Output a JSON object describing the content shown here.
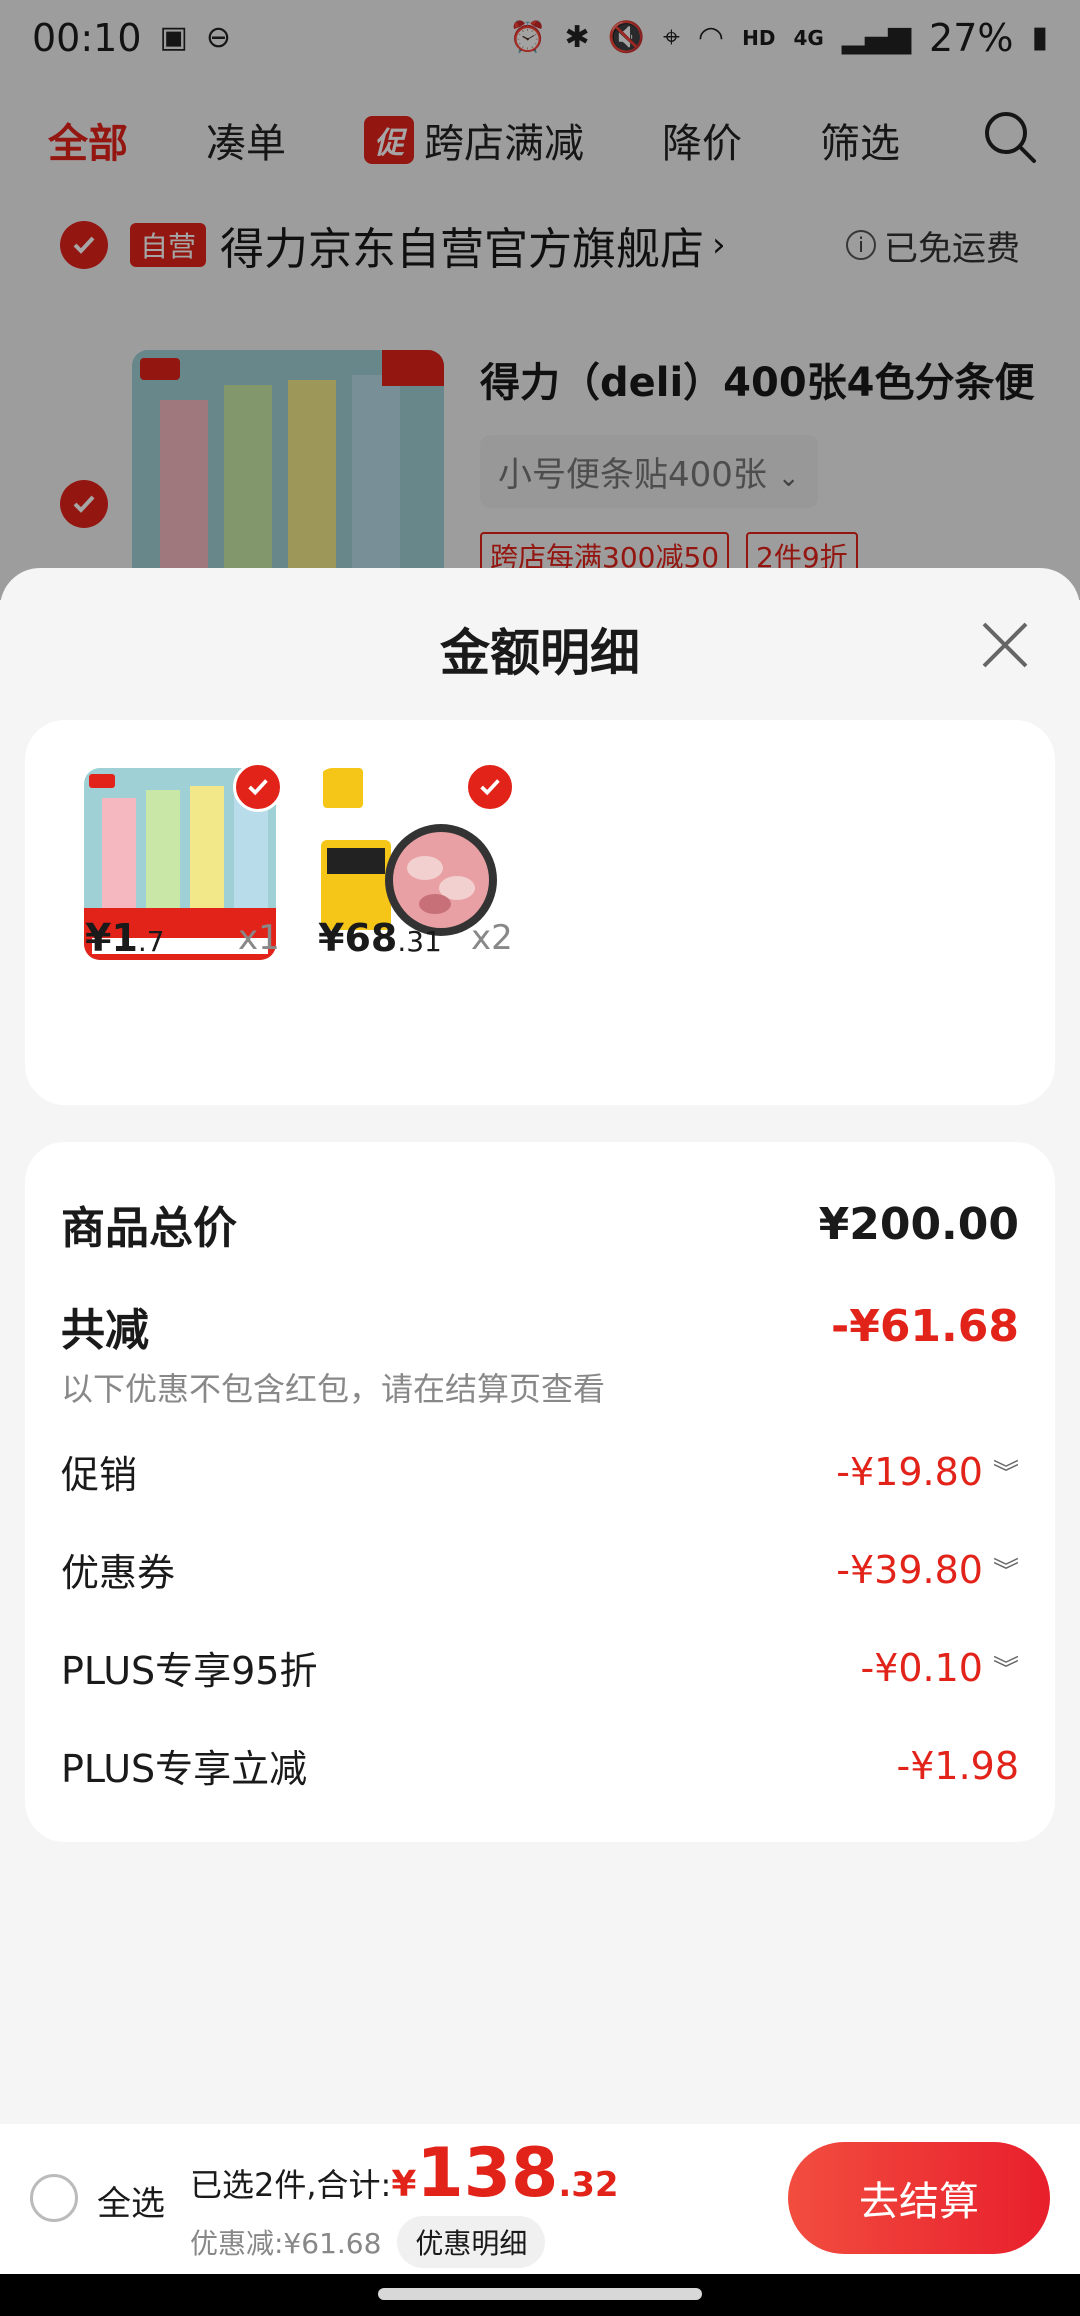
{
  "status_bar": {
    "time": "00:10",
    "network": "HD",
    "signal": "4G",
    "battery": "27%"
  },
  "top_nav": {
    "tabs": [
      {
        "label": "全部",
        "active": true
      },
      {
        "label": "凑单",
        "active": false
      },
      {
        "label": "跨店满减",
        "active": false,
        "badge": "促"
      },
      {
        "label": "降价",
        "active": false
      },
      {
        "label": "筛选",
        "active": false
      }
    ]
  },
  "shop": {
    "badge": "自营",
    "name": "得力京东自营官方旗舰店",
    "shipping": "已免运费"
  },
  "product": {
    "title": "得力（deli）400张4色分条便",
    "variant": "小号便条贴400张",
    "tags": [
      "跨店每满300减50",
      "2件9折"
    ]
  },
  "sheet": {
    "title": "金额明细",
    "items": [
      {
        "price_int": "¥1",
        "price_dec": ".7",
        "qty": "x1"
      },
      {
        "price_int": "¥68",
        "price_dec": ".31",
        "qty": "x2"
      }
    ],
    "total_label": "商品总价",
    "total_value": "¥200.00",
    "reduce_label": "共减",
    "reduce_value": "-¥61.68",
    "reduce_note": "以下优惠不包含红包，请在结算页查看",
    "lines": [
      {
        "label": "促销",
        "value": "-¥19.80",
        "expandable": true
      },
      {
        "label": "优惠券",
        "value": "-¥39.80",
        "expandable": true
      },
      {
        "label": "PLUS专享95折",
        "value": "-¥0.10",
        "expandable": true
      },
      {
        "label": "PLUS专享立减",
        "value": "-¥1.98",
        "expandable": false
      }
    ]
  },
  "bottom_bar": {
    "select_all": "全选",
    "selected_text": "已选2件,合计:",
    "yen": "¥",
    "total_int": "138",
    "total_dec": ".32",
    "discount": "优惠减:¥61.68",
    "detail_button": "优惠明细",
    "checkout": "去结算"
  },
  "colors": {
    "accent": "#e2231a"
  }
}
